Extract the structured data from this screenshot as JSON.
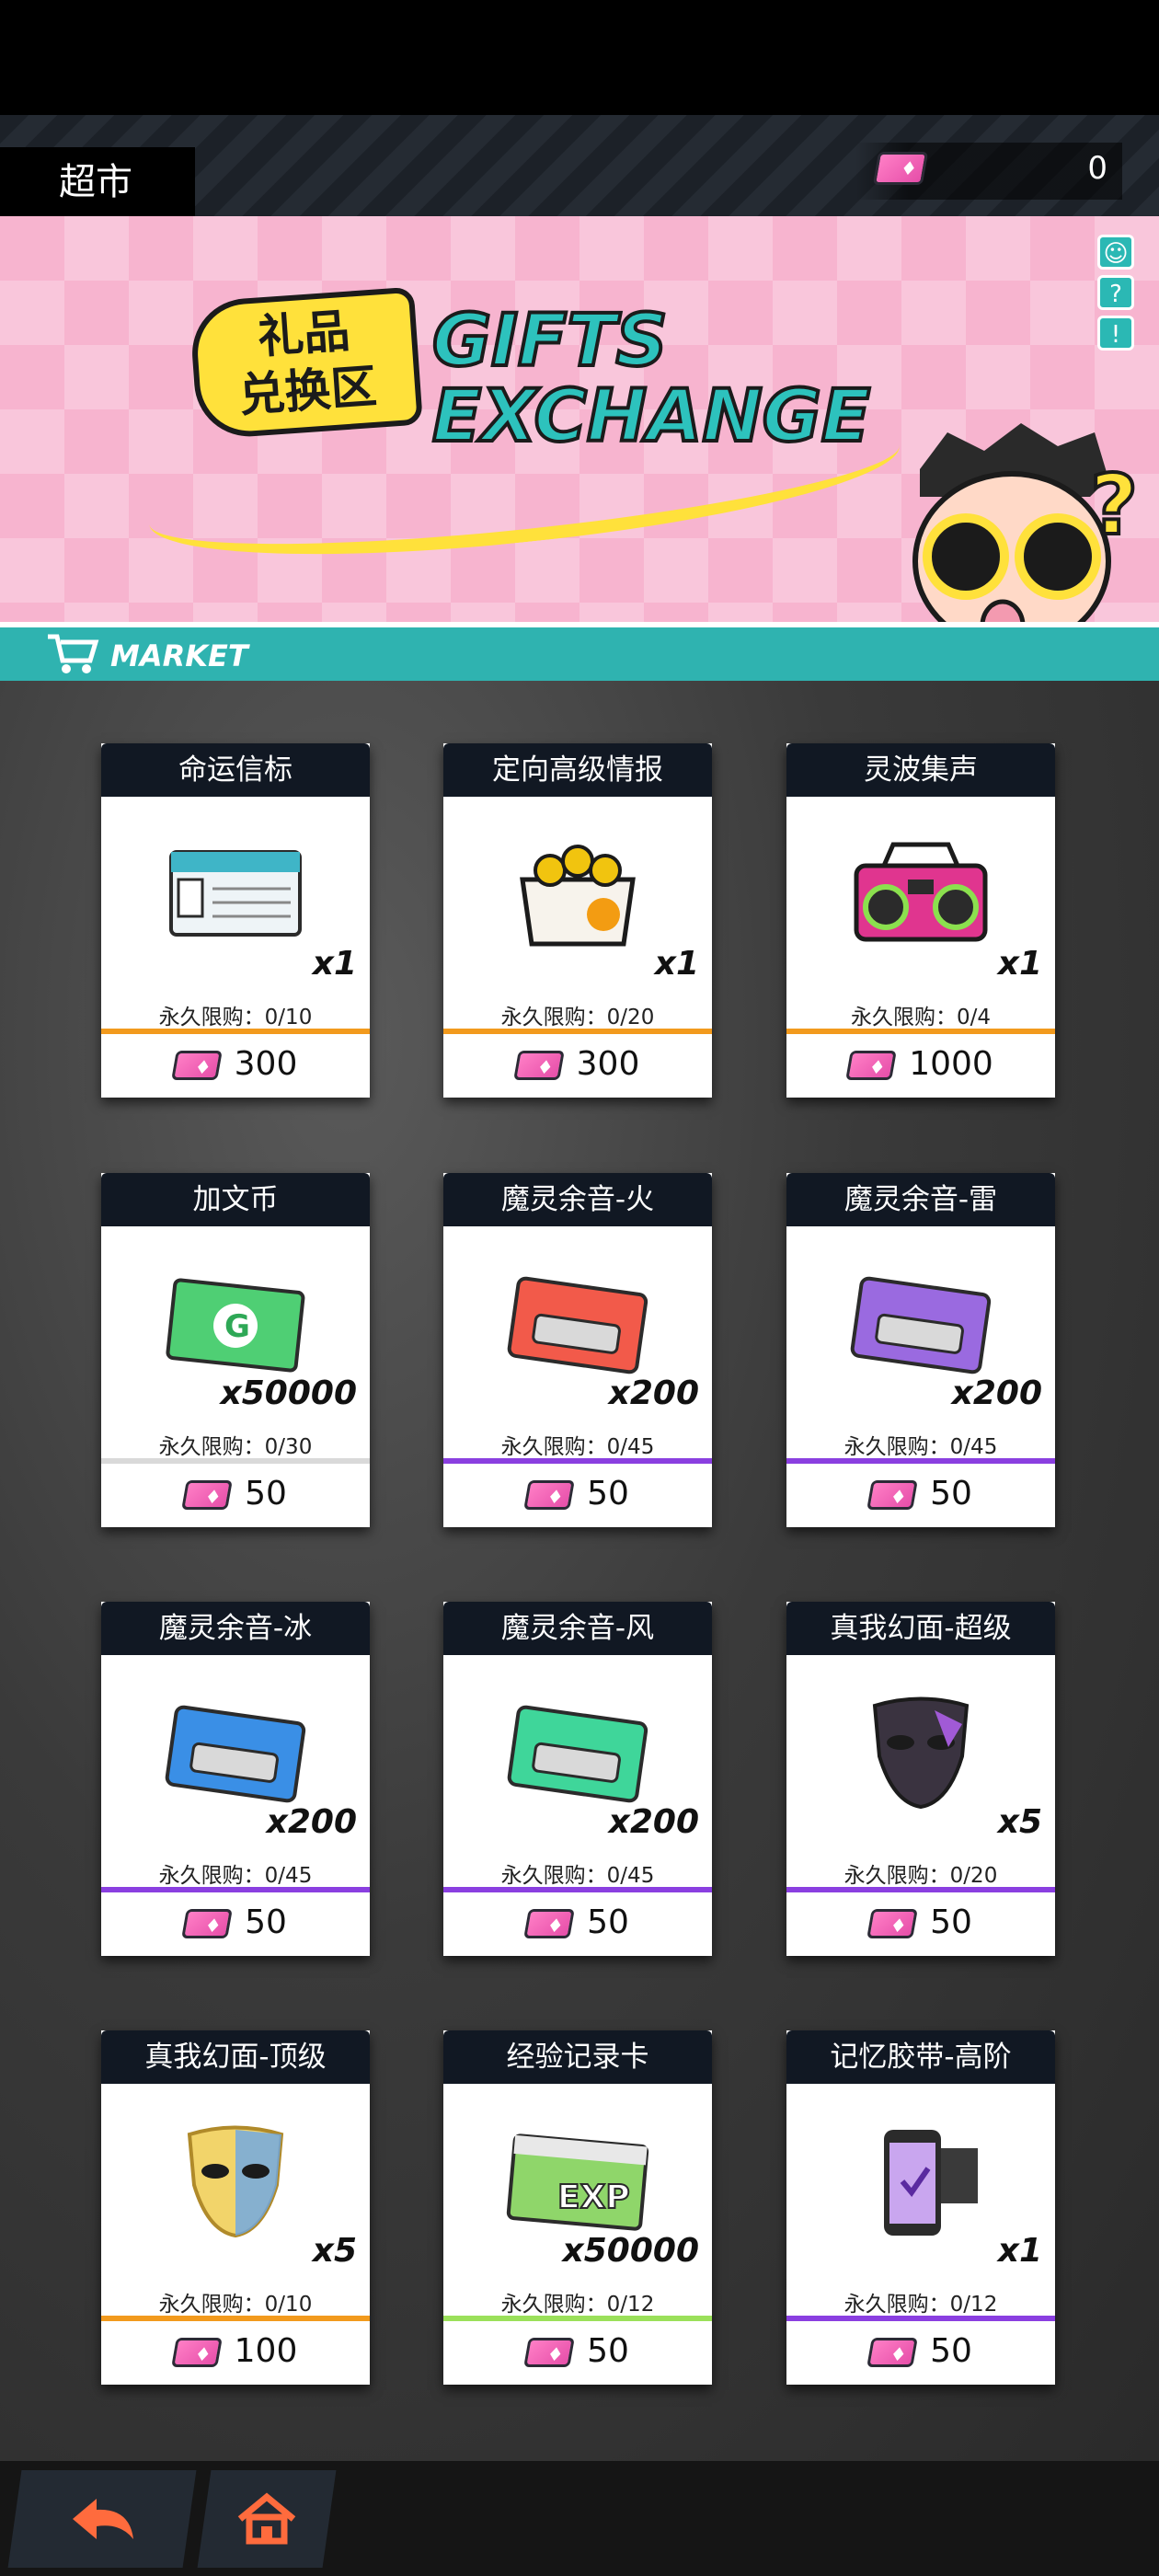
{
  "header": {
    "title": "超市",
    "currency_amount": "0"
  },
  "banner": {
    "cn_title": "礼品\n兑换区",
    "en_title": "GIFTS\nEXCHANGE",
    "market_label": "MARKET",
    "side_icons": [
      "rabbit-icon",
      "help-icon",
      "alert-icon"
    ]
  },
  "items": [
    {
      "name": "命运信标",
      "qty": "x1",
      "limit": "永久限购：0/10",
      "price": "300",
      "bar_color": "#f29a1d",
      "icon": "ticket-card-icon"
    },
    {
      "name": "定向高级情报",
      "qty": "x1",
      "limit": "永久限购：0/20",
      "price": "300",
      "bar_color": "#f29a1d",
      "icon": "box-icon"
    },
    {
      "name": "灵波集声",
      "qty": "x1",
      "limit": "永久限购：0/4",
      "price": "1000",
      "bar_color": "#f29a1d",
      "icon": "boombox-icon"
    },
    {
      "name": "加文币",
      "qty": "x50000",
      "limit": "永久限购：0/30",
      "price": "50",
      "bar_color": "#d9d9d9",
      "icon": "green-card-icon"
    },
    {
      "name": "魔灵余音-火",
      "qty": "x200",
      "limit": "永久限购：0/45",
      "price": "50",
      "bar_color": "#8a3fe0",
      "icon": "cassette-fire-icon"
    },
    {
      "name": "魔灵余音-雷",
      "qty": "x200",
      "limit": "永久限购：0/45",
      "price": "50",
      "bar_color": "#8a3fe0",
      "icon": "cassette-thunder-icon"
    },
    {
      "name": "魔灵余音-冰",
      "qty": "x200",
      "limit": "永久限购：0/45",
      "price": "50",
      "bar_color": "#8a3fe0",
      "icon": "cassette-ice-icon"
    },
    {
      "name": "魔灵余音-风",
      "qty": "x200",
      "limit": "永久限购：0/45",
      "price": "50",
      "bar_color": "#8a3fe0",
      "icon": "cassette-wind-icon"
    },
    {
      "name": "真我幻面-超级",
      "qty": "x5",
      "limit": "永久限购：0/20",
      "price": "50",
      "bar_color": "#8a3fe0",
      "icon": "dark-mask-icon"
    },
    {
      "name": "真我幻面-顶级",
      "qty": "x5",
      "limit": "永久限购：0/10",
      "price": "100",
      "bar_color": "#f29a1d",
      "icon": "gold-mask-icon"
    },
    {
      "name": "经验记录卡",
      "qty": "x50000",
      "limit": "永久限购：0/12",
      "price": "50",
      "bar_color": "#9be05a",
      "icon": "exp-card-icon"
    },
    {
      "name": "记忆胶带-高阶",
      "qty": "x1",
      "limit": "永久限购：0/12",
      "price": "50",
      "bar_color": "#8a3fe0",
      "icon": "memory-film-icon"
    }
  ],
  "colors": {
    "accent_teal": "#2fb3b0",
    "ticket_pink": "#e64ea9",
    "card_header": "#111823"
  },
  "nav": {
    "back_icon": "back-arrow-icon",
    "home_icon": "home-icon"
  }
}
